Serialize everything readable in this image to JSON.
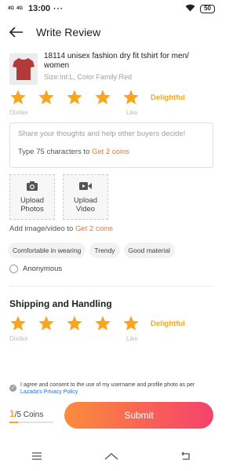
{
  "status_bar": {
    "signal1": "4G",
    "signal2": "4G",
    "time": "13:00",
    "dots": "···",
    "battery": "50"
  },
  "header": {
    "title": "Write Review"
  },
  "product": {
    "name": "18114 unisex fashion dry fit tshirt for men/ women",
    "variant": "Size:Int:L, Color Family:Red"
  },
  "product_rating": {
    "stars": 5,
    "label": "Delightful",
    "scale_low": "Dislike",
    "scale_high": "Like"
  },
  "review_input": {
    "placeholder": "Share your thoughts and help other buyers decide!",
    "hint_prefix": "Type 75 characters to ",
    "hint_reward": "Get 2 coins"
  },
  "media": {
    "photos_line1": "Upload",
    "photos_line2": "Photos",
    "video_line1": "Upload",
    "video_line2": "Video",
    "hint_prefix": "Add image/video to ",
    "hint_reward": "Get 2 coins"
  },
  "tags": [
    "Comfortable in wearing",
    "Trendy",
    "Good material"
  ],
  "anonymous": {
    "label": "Anonymous"
  },
  "shipping": {
    "title": "Shipping and Handling",
    "stars": 5,
    "label": "Delightful",
    "scale_low": "Dislike",
    "scale_high": "Like"
  },
  "consent": {
    "text": "I agree and consent to the use of my username and profile photo as per ",
    "link": "Lazada's Privacy Policy"
  },
  "coins": {
    "current": "1",
    "total": "/5 Coins",
    "progress": 0.2
  },
  "submit": {
    "label": "Submit"
  },
  "colors": {
    "accent": "#f6a623",
    "orange": "#f57224",
    "link": "#1a73e8"
  }
}
